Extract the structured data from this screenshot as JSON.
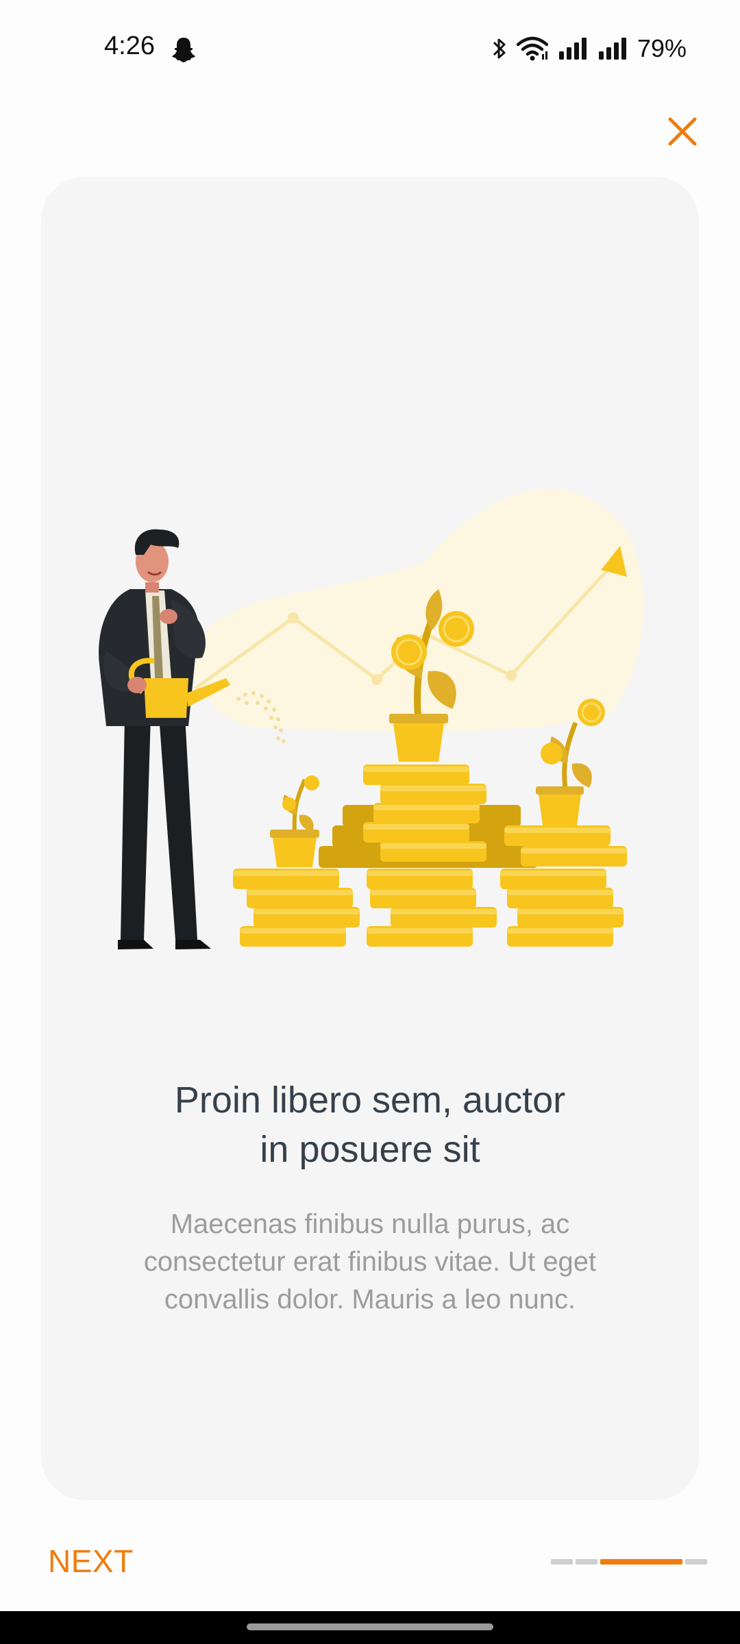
{
  "status_bar": {
    "time": "4:26",
    "battery": "79%",
    "icons": [
      "snapchat-icon",
      "bluetooth-icon",
      "wifi-icon",
      "signal-icon",
      "signal-icon"
    ]
  },
  "card": {
    "title_line1": "Proin libero sem, auctor",
    "title_line2": "in posuere sit",
    "desc_line1": "Maecenas finibus nulla purus, ac",
    "desc_line2": "consectetur erat finibus vitae. Ut eget",
    "desc_line3": "convallis dolor. Mauris a leo nunc."
  },
  "footer": {
    "next_label": "NEXT",
    "page_count": 4,
    "active_page": 3
  },
  "colors": {
    "accent": "#f07c0d",
    "card_bg": "#f5f5f5",
    "title": "#36404a",
    "description": "#9c9c9c",
    "coin": "#f7c51e"
  }
}
